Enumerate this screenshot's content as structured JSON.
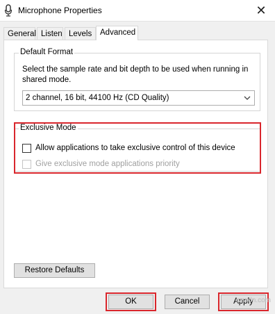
{
  "window": {
    "title": "Microphone Properties",
    "close_glyph": "✕",
    "icon": "microphone-icon"
  },
  "tabs": [
    {
      "label": "General",
      "active": false
    },
    {
      "label": "Listen",
      "active": false
    },
    {
      "label": "Levels",
      "active": false
    },
    {
      "label": "Advanced",
      "active": true
    }
  ],
  "default_format": {
    "title": "Default Format",
    "description": "Select the sample rate and bit depth to be used when running in shared mode.",
    "selected": "2 channel, 16 bit, 44100 Hz (CD Quality)"
  },
  "exclusive_mode": {
    "title": "Exclusive Mode",
    "allow_label": "Allow applications to take exclusive control of this device",
    "allow_checked": false,
    "priority_label": "Give exclusive mode applications priority",
    "priority_checked": false,
    "priority_enabled": false
  },
  "buttons": {
    "restore_defaults": "Restore Defaults",
    "ok": "OK",
    "cancel": "Cancel",
    "apply": "Apply"
  },
  "watermark": "wsxdn.com",
  "colors": {
    "highlight": "#d9262c",
    "background": "#f0f0f0",
    "panel": "#ffffff"
  }
}
